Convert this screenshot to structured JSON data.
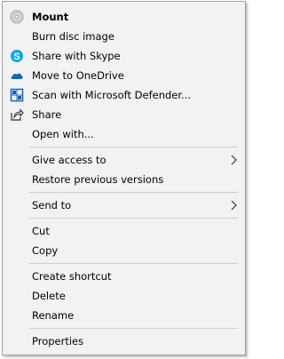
{
  "menu": {
    "mount": "Mount",
    "burn": "Burn disc image",
    "skype": "Share with Skype",
    "onedrive": "Move to OneDrive",
    "defender": "Scan with Microsoft Defender...",
    "share": "Share",
    "open_with": "Open with...",
    "give_access": "Give access to",
    "restore": "Restore previous versions",
    "send_to": "Send to",
    "cut": "Cut",
    "copy": "Copy",
    "create_shortcut": "Create shortcut",
    "delete": "Delete",
    "rename": "Rename",
    "properties": "Properties"
  },
  "icons": {
    "mount": "disc-icon",
    "skype": "skype-icon",
    "onedrive": "onedrive-cloud-icon",
    "defender": "defender-shield-icon",
    "share": "share-icon"
  },
  "colors": {
    "skype": "#00a9f0",
    "onedrive": "#0f6cbd",
    "defender": "#0f62b4"
  }
}
